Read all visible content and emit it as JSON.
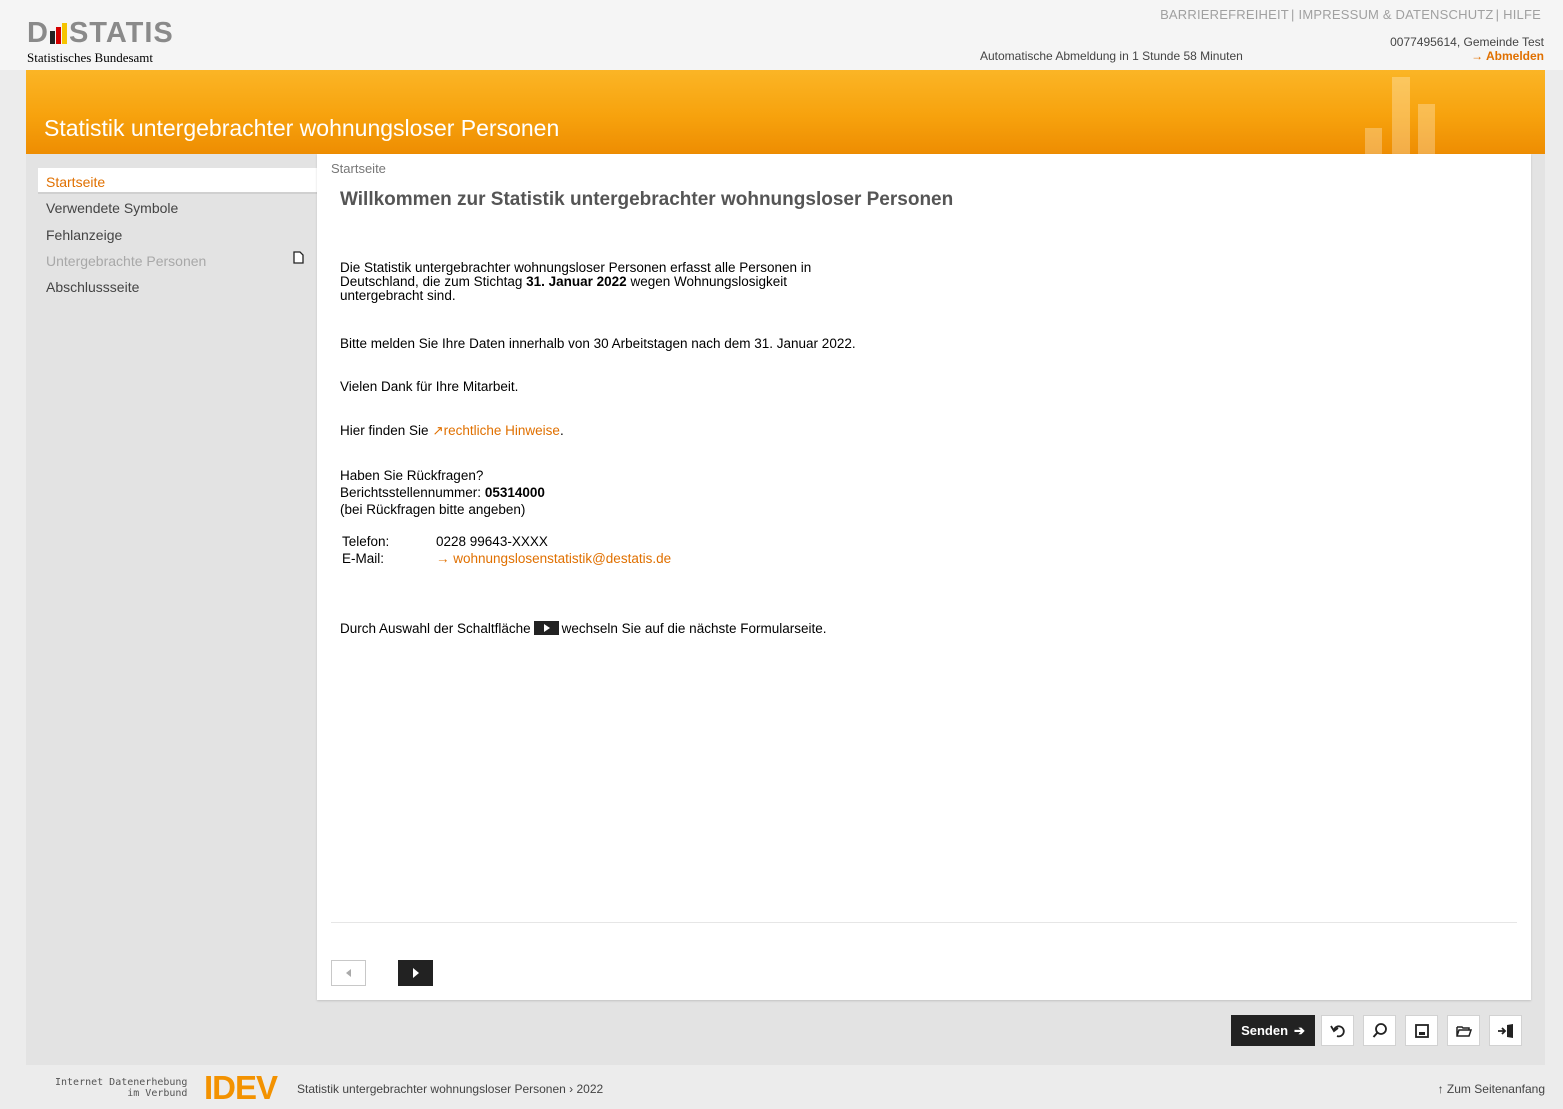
{
  "header": {
    "logo_text": "STATIS",
    "logo_subtitle": "Statistisches Bundesamt",
    "meta_nav": [
      "BARRIEREFREIHEIT",
      "IMPRESSUM & DATENSCHUTZ",
      "HILFE"
    ],
    "auto_logout": "Automatische Abmeldung in 1 Stunde 58 Minuten",
    "user": "0077495614, Gemeinde Test",
    "logout_label": "Abmelden"
  },
  "banner": {
    "title": "Statistik untergebrachter wohnungsloser Personen"
  },
  "sidebar": {
    "items": [
      {
        "label": "Startseite",
        "state": "active"
      },
      {
        "label": "Verwendete Symbole",
        "state": "normal"
      },
      {
        "label": "Fehlanzeige",
        "state": "normal"
      },
      {
        "label": "Untergebrachte Personen",
        "state": "disabled",
        "icon": "document-icon"
      },
      {
        "label": "Abschlussseite",
        "state": "normal"
      }
    ]
  },
  "main": {
    "breadcrumb": "Startseite",
    "title": "Willkommen zur Statistik untergebrachter wohnungsloser Personen",
    "intro_line1": "Die Statistik untergebrachter wohnungsloser Personen erfasst alle Personen in",
    "intro_line2_pre": "Deutschland, die zum Stichtag ",
    "intro_line2_bold": "31. Januar 2022",
    "intro_line2_post": " wegen Wohnungslosigkeit",
    "intro_line3": "untergebracht sind.",
    "deadline": "Bitte melden Sie Ihre Daten innerhalb von 30 Arbeitstagen nach dem 31. Januar 2022.",
    "thanks": "Vielen Dank für Ihre Mitarbeit.",
    "legal_pre": "Hier finden Sie ",
    "legal_link": "rechtliche Hinweise",
    "legal_post": ".",
    "questions": "Haben Sie Rückfragen?",
    "reporting_label": "Berichtsstellennummer: ",
    "reporting_number": "05314000",
    "reporting_hint": "(bei Rückfragen bitte angeben)",
    "phone_label": "Telefon:",
    "phone_value": "0228 99643-XXXX",
    "email_label": "E-Mail:",
    "email_value": "wohnungslosenstatistik@destatis.de",
    "next_hint_pre": "Durch Auswahl der Schaltfläche",
    "next_hint_post": "wechseln Sie auf die nächste Formularseite."
  },
  "toolbar": {
    "send_label": "Senden",
    "tools": [
      "undo-icon",
      "search-icon",
      "save-icon",
      "open-folder-icon",
      "exit-icon"
    ]
  },
  "footer": {
    "idev_line1": "Internet Datenerhebung",
    "idev_line2": "im Verbund",
    "idev_logo": "IDEV",
    "path": "Statistik untergebrachter wohnungsloser Personen › 2022",
    "to_top": "↑ Zum Seitenanfang"
  },
  "colors": {
    "accent": "#e07000",
    "banner": "#f7a20d",
    "dark_button": "#222222"
  }
}
